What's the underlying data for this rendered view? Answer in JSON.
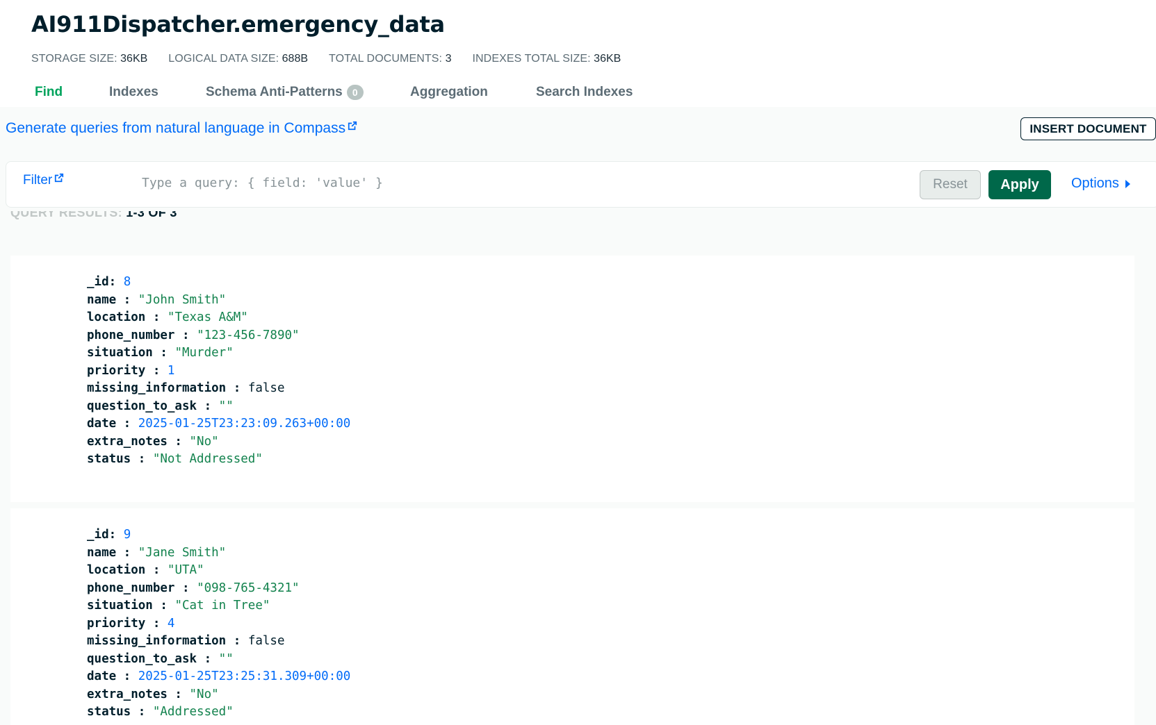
{
  "collection": {
    "title": "AI911Dispatcher.emergency_data"
  },
  "stats": [
    {
      "key": "STORAGE SIZE:",
      "value": "36KB"
    },
    {
      "key": "LOGICAL DATA SIZE:",
      "value": "688B"
    },
    {
      "key": "TOTAL DOCUMENTS:",
      "value": "3"
    },
    {
      "key": "INDEXES TOTAL SIZE:",
      "value": "36KB"
    }
  ],
  "tabs": [
    {
      "label": "Find",
      "active": true
    },
    {
      "label": "Indexes"
    },
    {
      "label": "Schema Anti-Patterns",
      "badge": "0"
    },
    {
      "label": "Aggregation"
    },
    {
      "label": "Search Indexes"
    }
  ],
  "toolbar": {
    "nl_link": "Generate queries from natural language in Compass",
    "insert_label": "INSERT DOCUMENT"
  },
  "filter": {
    "label": "Filter",
    "placeholder": "Type a query: { field: 'value' }",
    "reset_label": "Reset",
    "apply_label": "Apply",
    "options_label": "Options"
  },
  "results": {
    "label": "QUERY RESULTS:",
    "range": "1-3 OF 3"
  },
  "documents": [
    {
      "fields": [
        {
          "key": "_id:",
          "value": "8",
          "type": "num"
        },
        {
          "key": "name :",
          "value": "\"John Smith\"",
          "type": "str"
        },
        {
          "key": "location :",
          "value": "\"Texas A&M\"",
          "type": "str"
        },
        {
          "key": "phone_number :",
          "value": "\"123-456-7890\"",
          "type": "str"
        },
        {
          "key": "situation :",
          "value": "\"Murder\"",
          "type": "str"
        },
        {
          "key": "priority :",
          "value": "1",
          "type": "num"
        },
        {
          "key": "missing_information :",
          "value": "false",
          "type": "bool"
        },
        {
          "key": "question_to_ask :",
          "value": "\"\"",
          "type": "str"
        },
        {
          "key": "date :",
          "value": "2025-01-25T23:23:09.263+00:00",
          "type": "date"
        },
        {
          "key": "extra_notes :",
          "value": "\"No\"",
          "type": "str"
        },
        {
          "key": "status :",
          "value": "\"Not Addressed\"",
          "type": "str"
        }
      ]
    },
    {
      "fields": [
        {
          "key": "_id:",
          "value": "9",
          "type": "num"
        },
        {
          "key": "name :",
          "value": "\"Jane Smith\"",
          "type": "str"
        },
        {
          "key": "location :",
          "value": "\"UTA\"",
          "type": "str"
        },
        {
          "key": "phone_number :",
          "value": "\"098-765-4321\"",
          "type": "str"
        },
        {
          "key": "situation :",
          "value": "\"Cat in Tree\"",
          "type": "str"
        },
        {
          "key": "priority :",
          "value": "4",
          "type": "num"
        },
        {
          "key": "missing_information :",
          "value": "false",
          "type": "bool"
        },
        {
          "key": "question_to_ask :",
          "value": "\"\"",
          "type": "str"
        },
        {
          "key": "date :",
          "value": "2025-01-25T23:25:31.309+00:00",
          "type": "date"
        },
        {
          "key": "extra_notes :",
          "value": "\"No\"",
          "type": "str"
        },
        {
          "key": "status :",
          "value": "\"Addressed\"",
          "type": "str"
        }
      ]
    }
  ],
  "icons": {
    "external_link": "external-link-icon",
    "options_caret": "caret-right-icon"
  },
  "colors": {
    "accent_green": "#00a35c",
    "apply_green": "#00684a",
    "link_blue": "#016bf8",
    "string_green": "#12824d"
  }
}
